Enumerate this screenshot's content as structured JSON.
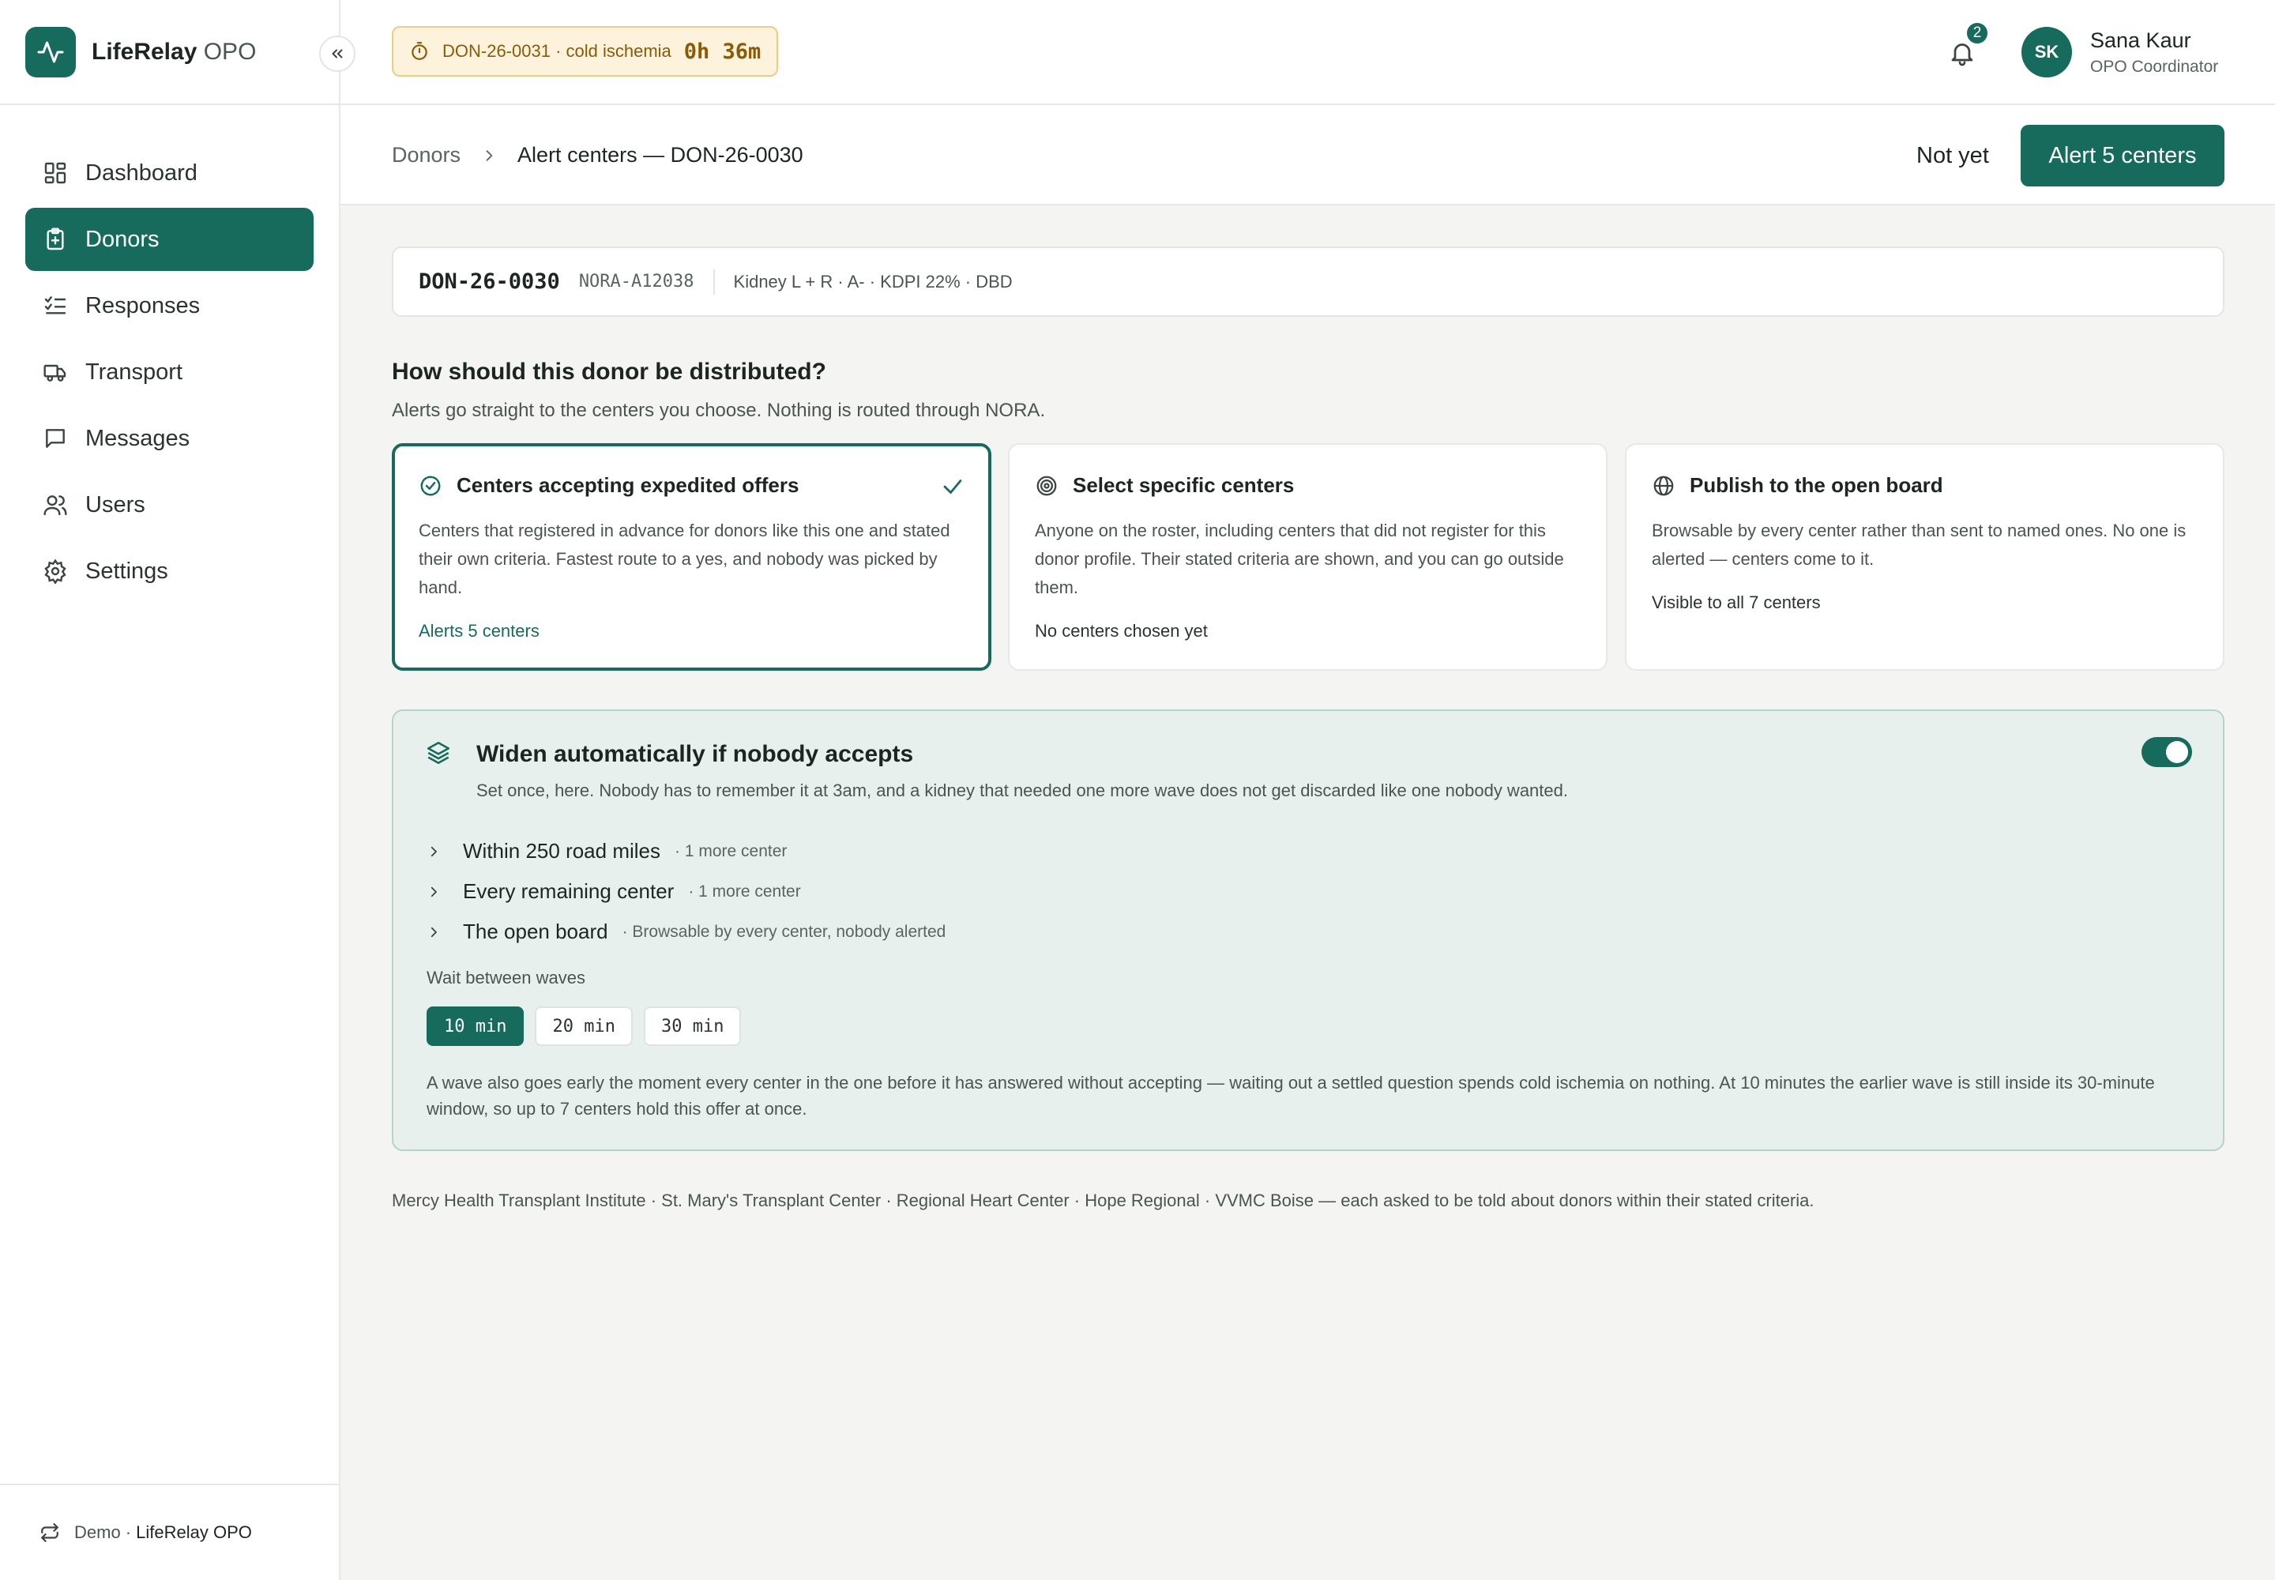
{
  "app": {
    "brand_bold": "LifeRelay",
    "brand_rest": " OPO"
  },
  "sidebar": {
    "items": [
      {
        "label": "Dashboard",
        "icon": "dashboard-icon"
      },
      {
        "label": "Donors",
        "icon": "clipboard-plus-icon",
        "active": true
      },
      {
        "label": "Responses",
        "icon": "checklist-icon"
      },
      {
        "label": "Transport",
        "icon": "truck-icon"
      },
      {
        "label": "Messages",
        "icon": "message-icon"
      },
      {
        "label": "Users",
        "icon": "users-icon"
      },
      {
        "label": "Settings",
        "icon": "gear-icon"
      }
    ],
    "footer_prefix": "Demo ·",
    "footer_org": "LifeRelay OPO"
  },
  "topbar": {
    "timer_label": "DON-26-0031 · cold ischemia",
    "timer_value": "0h 36m",
    "notification_count": "2",
    "user_initials": "SK",
    "user_name": "Sana Kaur",
    "user_role": "OPO Coordinator"
  },
  "pagebar": {
    "crumb_parent": "Donors",
    "crumb_current": "Alert centers — DON-26-0030",
    "secondary_action": "Not yet",
    "primary_action": "Alert 5 centers"
  },
  "donor": {
    "id": "DON-26-0030",
    "nora_id": "NORA-A12038",
    "summary": "Kidney L + R · A- · KDPI 22% · DBD"
  },
  "distribution": {
    "question": "How should this donor be distributed?",
    "subtitle": "Alerts go straight to the centers you choose. Nothing is routed through NORA.",
    "options": [
      {
        "title": "Centers accepting expedited offers",
        "body": "Centers that registered in advance for donors like this one and stated their own criteria. Fastest route to a yes, and nobody was picked by hand.",
        "footer": "Alerts 5 centers",
        "icon": "check-circle-icon",
        "selected": true
      },
      {
        "title": "Select specific centers",
        "body": "Anyone on the roster, including centers that did not register for this donor profile. Their stated criteria are shown, and you can go outside them.",
        "footer": "No centers chosen yet",
        "icon": "target-icon",
        "selected": false
      },
      {
        "title": "Publish to the open board",
        "body": "Browsable by every center rather than sent to named ones. No one is alerted — centers come to it.",
        "footer": "Visible to all 7 centers",
        "icon": "globe-icon",
        "selected": false
      }
    ]
  },
  "widen": {
    "title": "Widen automatically if nobody accepts",
    "description": "Set once, here. Nobody has to remember it at 3am, and a kidney that needed one more wave does not get discarded like one nobody wanted.",
    "enabled": true,
    "waves": [
      {
        "label": "Within 250 road miles",
        "meta": "· 1 more center"
      },
      {
        "label": "Every remaining center",
        "meta": "· 1 more center"
      },
      {
        "label": "The open board",
        "meta": "· Browsable by every center, nobody alerted"
      }
    ],
    "wait_label": "Wait between waves",
    "wait_options": [
      "10 min",
      "20 min",
      "30 min"
    ],
    "wait_selected": "10 min",
    "note": "A wave also goes early the moment every center in the one before it has answered without accepting — waiting out a settled question spends cold ischemia on nothing. At 10 minutes the earlier wave is still inside its 30-minute window, so up to 7 centers hold this offer at once."
  },
  "centers_note": "Mercy Health Transplant Institute · St. Mary's Transplant Center · Regional Heart Center · Hope Regional · VVMC Boise — each asked to be told about donors within their stated criteria.",
  "colors": {
    "accent": "#176b5c",
    "warning_bg": "#fdf3dc",
    "panel_bg": "#e8f0ee"
  }
}
